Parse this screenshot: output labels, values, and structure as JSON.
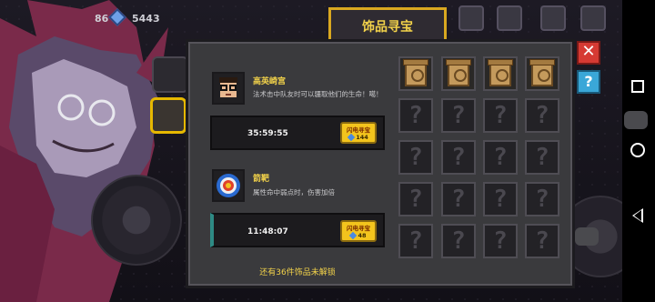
{
  "top_bar": {
    "gem_count": "5443",
    "partial_count": "86"
  },
  "title": "饰品寻宝",
  "entries": [
    {
      "name": "高英崎宫",
      "description": "法术击中队友时可以疆取他们的生命！噶！",
      "timer": "35:59:55",
      "flash_label": "闪电寻宝",
      "flash_cost": "144",
      "icon": "nerd-face-icon"
    },
    {
      "name": "箭靶",
      "description": "属性命中弱点时，伤害加倍",
      "timer": "11:48:07",
      "flash_label": "闪电寻宝",
      "flash_cost": "48",
      "icon": "target-icon"
    }
  ],
  "unlock_text": "还有36件饰品未解锁",
  "grid": {
    "unlocked_count": 4,
    "unknown_symbol": "?"
  },
  "buttons": {
    "close": "✕",
    "help": "?"
  },
  "colors": {
    "accent_gold": "#f2d24a",
    "close_red": "#d63a33",
    "help_blue": "#3aa7d8",
    "flash_yellow": "#f3c41d"
  }
}
